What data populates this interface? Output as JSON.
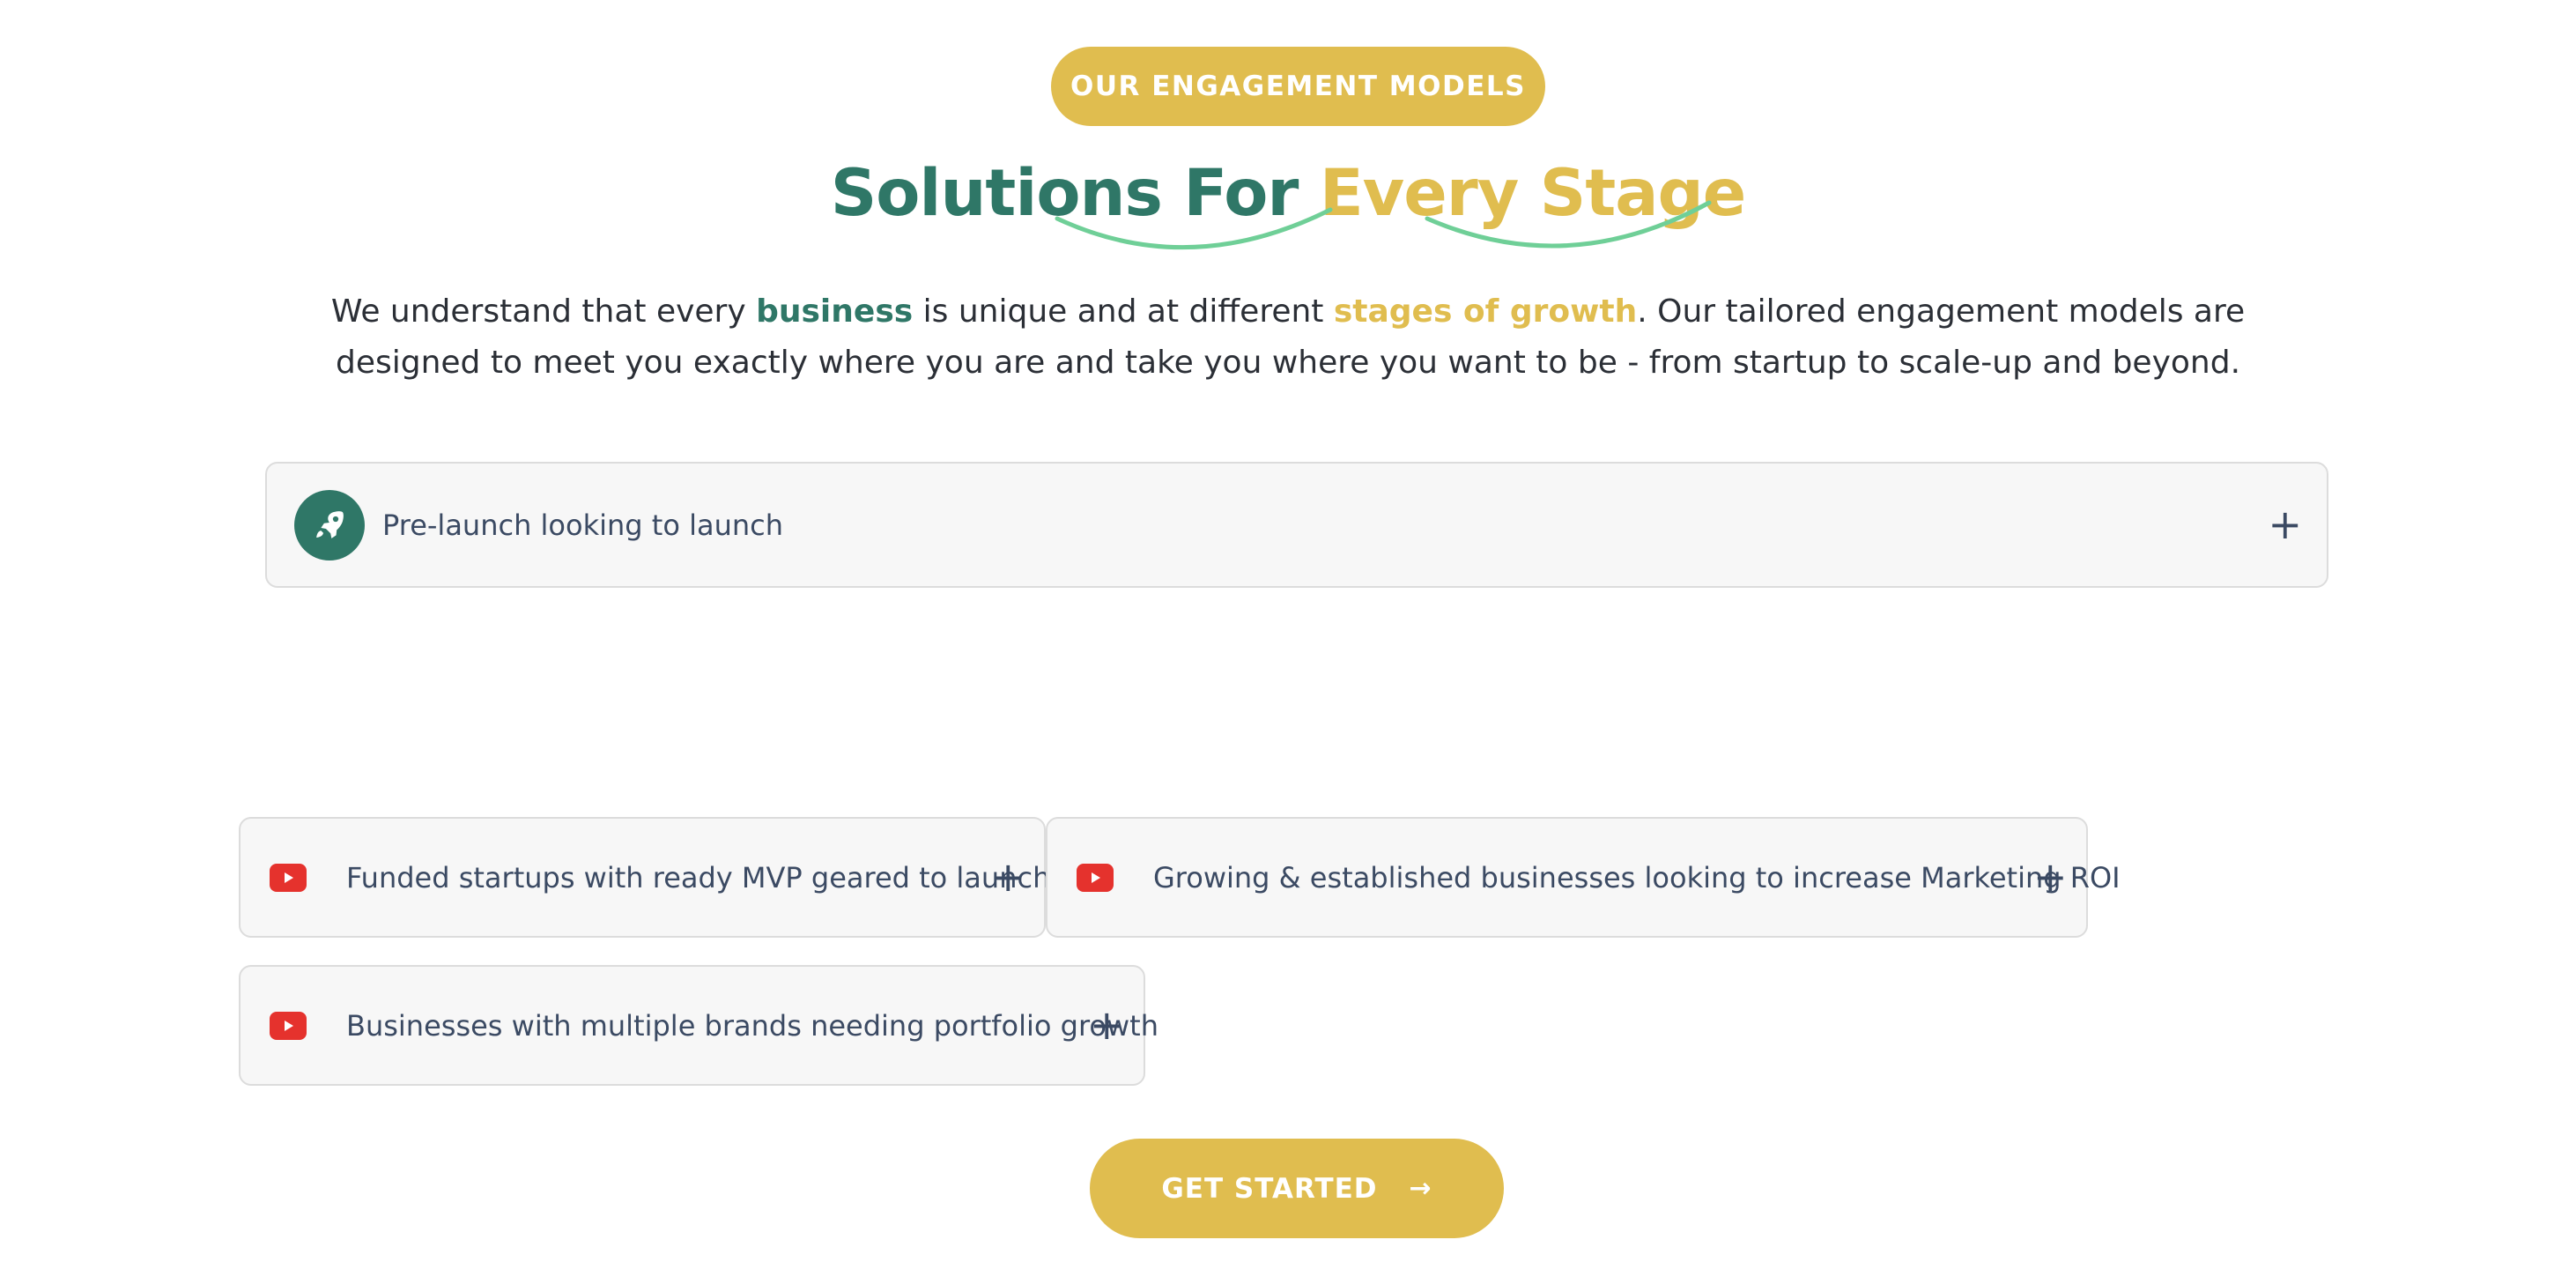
{
  "section": {
    "eyebrow": "OUR ENGAGEMENT MODELS",
    "heading_part1": "Solutions For",
    "heading_part2": "Every Stage",
    "intro": {
      "t1": "We understand that every ",
      "h1": "business",
      "t2": " is unique and at different ",
      "h2": "stages of growth",
      "t3": ". Our tailored engagement models are designed to meet you exactly where you are and take you where you want to be - from startup to scale-up and beyond."
    }
  },
  "accordion": {
    "main": {
      "label": "Pre-launch looking to launch",
      "icon": "rocket-icon",
      "toggle": "+"
    },
    "items": [
      {
        "label": "Funded startups with ready MVP geared to launch",
        "icon": "youtube-icon",
        "toggle": "+"
      },
      {
        "label": "Growing & established businesses looking to increase Marketing ROI",
        "icon": "youtube-icon",
        "toggle": "+"
      },
      {
        "label": "Businesses with multiple brands needing portfolio growth",
        "icon": "youtube-icon",
        "toggle": "+"
      }
    ]
  },
  "cta": {
    "label": "GET STARTED",
    "arrow": "→"
  },
  "colors": {
    "brand_green": "#2f7767",
    "brand_gold": "#e0bd4f",
    "swoosh_green": "#6fcf97",
    "youtube_red": "#e5322d"
  }
}
